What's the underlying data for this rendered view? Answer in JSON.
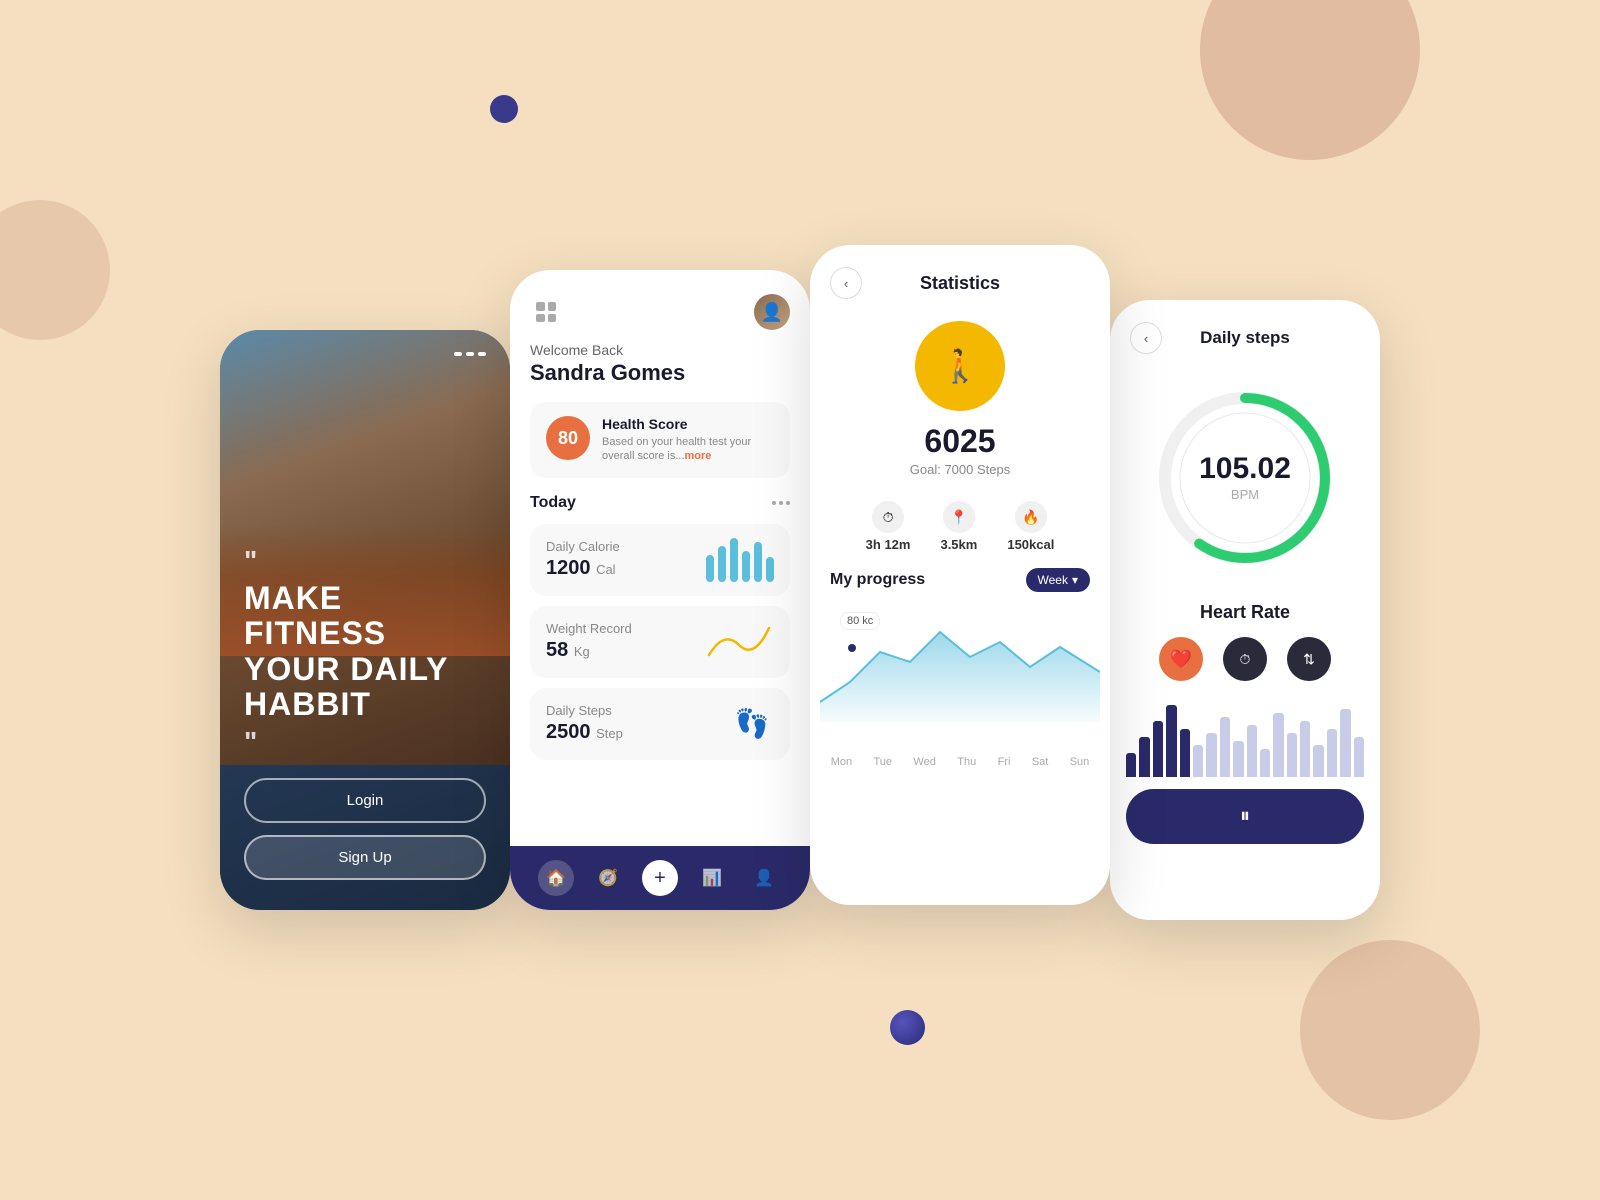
{
  "background": {
    "color": "#f5dfc0"
  },
  "phone1": {
    "hero_text": "Make Fitness Your Daily Habbit",
    "login_label": "Login",
    "signup_label": "Sign Up"
  },
  "phone2": {
    "welcome": "Welcome Back",
    "user_name": "Sandra Gomes",
    "health_score": {
      "score": "80",
      "title": "Health Score",
      "description": "Based on your health test your overall score is...",
      "more_label": "more"
    },
    "today_label": "Today",
    "cards": [
      {
        "title": "Daily Calorie",
        "value": "1200",
        "unit": "Cal"
      },
      {
        "title": "Weight Record",
        "value": "58",
        "unit": "Kg"
      },
      {
        "title": "Daily Steps",
        "value": "2500",
        "unit": "Step"
      }
    ],
    "nav": [
      "home",
      "compass",
      "plus",
      "chart",
      "user"
    ]
  },
  "phone3": {
    "title": "Statistics",
    "steps_count": "6025",
    "steps_goal": "Goal: 7000 Steps",
    "metrics": [
      {
        "icon": "⏱",
        "value": "3h 12m"
      },
      {
        "icon": "📍",
        "value": "3.5km"
      },
      {
        "icon": "🔥",
        "value": "150kcal"
      }
    ],
    "my_progress_label": "My progress",
    "week_label": "Week",
    "chart_label": "80 kc",
    "days": [
      "Mon",
      "Tue",
      "Wed",
      "Thu",
      "Fri",
      "Sat",
      "Sun"
    ]
  },
  "phone4": {
    "title": "Daily steps",
    "bpm_value": "105.02",
    "bpm_unit": "BPM",
    "heart_rate_label": "Heart Rate",
    "pause_label": "⏸"
  }
}
